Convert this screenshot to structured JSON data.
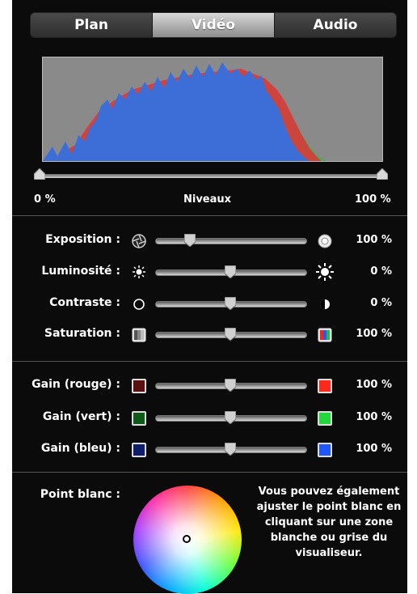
{
  "tabs": [
    {
      "label": "Plan"
    },
    {
      "label": "Vidéo"
    },
    {
      "label": "Audio"
    }
  ],
  "active_tab": "Vidéo",
  "levels": {
    "min_label": "0 %",
    "title": "Niveaux",
    "max_label": "100 %",
    "range": [
      0,
      100
    ]
  },
  "adjustments": [
    {
      "label": "Exposition :",
      "value_text": "100 %",
      "fraction": 0.22,
      "left_icon": "aperture-icon",
      "right_icon": "aperture-open-icon"
    },
    {
      "label": "Luminosité :",
      "value_text": "0 %",
      "fraction": 0.5,
      "left_icon": "sun-small-icon",
      "right_icon": "sun-large-icon"
    },
    {
      "label": "Contraste :",
      "value_text": "0 %",
      "fraction": 0.5,
      "left_icon": "contrast-low-icon",
      "right_icon": "contrast-high-icon"
    },
    {
      "label": "Saturation :",
      "value_text": "100 %",
      "fraction": 0.5,
      "left_icon": "desaturated-icon",
      "right_icon": "saturated-icon"
    }
  ],
  "gains": [
    {
      "label": "Gain (rouge) :",
      "value_text": "100 %",
      "fraction": 0.5,
      "low_color": "#5a1010",
      "high_color": "#ff2a1a"
    },
    {
      "label": "Gain (vert) :",
      "value_text": "100 %",
      "fraction": 0.5,
      "low_color": "#0f5a18",
      "high_color": "#22d83a"
    },
    {
      "label": "Gain (bleu) :",
      "value_text": "100 %",
      "fraction": 0.5,
      "low_color": "#0f1e6a",
      "high_color": "#1f57ff"
    }
  ],
  "white_point": {
    "label": "Point blanc :",
    "help": "Vous pouvez également ajuster le point blanc en cliquant sur une zone blanche ou grise du visualiseur."
  },
  "colors": {
    "background": "#0b0b0b",
    "histogram_bg": "#8a8a8a",
    "hist_blue": "#3d6ed8",
    "hist_red": "#d93a3a",
    "hist_green": "#35b84a"
  }
}
